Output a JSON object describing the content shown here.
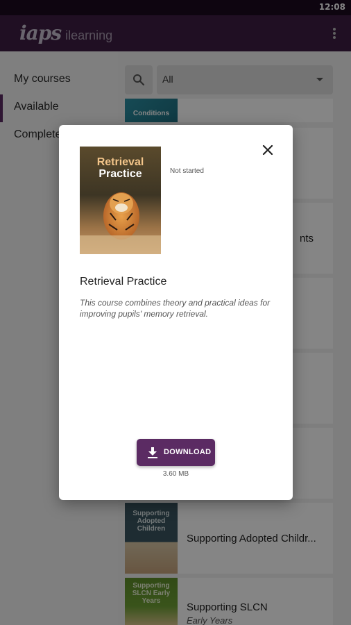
{
  "status_bar": {
    "time": "12:08"
  },
  "app_bar": {
    "brand": "iaps",
    "product": "ilearning",
    "more_icon": "more-vert-icon"
  },
  "sidebar": {
    "items": [
      {
        "label": "My courses",
        "active": false
      },
      {
        "label": "Available",
        "active": true
      },
      {
        "label": "Completed",
        "active": false
      }
    ]
  },
  "filter": {
    "search_icon": "search-icon",
    "selected": "All"
  },
  "courses": [
    {
      "thumb_title": "Conditions",
      "title": "",
      "subtitle": ""
    },
    {
      "thumb_title": "",
      "title": "",
      "subtitle": ""
    },
    {
      "thumb_title": "",
      "title": "nts",
      "subtitle": ""
    },
    {
      "thumb_title": "",
      "title": "",
      "subtitle": ""
    },
    {
      "thumb_title": "",
      "title": "",
      "subtitle": ""
    },
    {
      "thumb_title": "",
      "title": "",
      "subtitle": ""
    },
    {
      "thumb_title": "Supporting Adopted Children",
      "title": "Supporting Adopted Childr...",
      "subtitle": ""
    },
    {
      "thumb_title": "Supporting SLCN Early Years",
      "title": "Supporting SLCN",
      "subtitle": "Early Years"
    }
  ],
  "dialog": {
    "cover_line1": "Retrieval",
    "cover_line2": "Practice",
    "status": "Not started",
    "title": "Retrieval Practice",
    "description": "This course combines theory and practical ideas for improving pupils' memory retrieval.",
    "download_label": "DOWNLOAD",
    "size": "3.60 MB",
    "close_icon": "close-icon",
    "download_icon": "download-icon"
  },
  "colors": {
    "primary": "#5b2b63",
    "app_bar": "#3f1d44",
    "status_bar": "#1b0a1f"
  }
}
